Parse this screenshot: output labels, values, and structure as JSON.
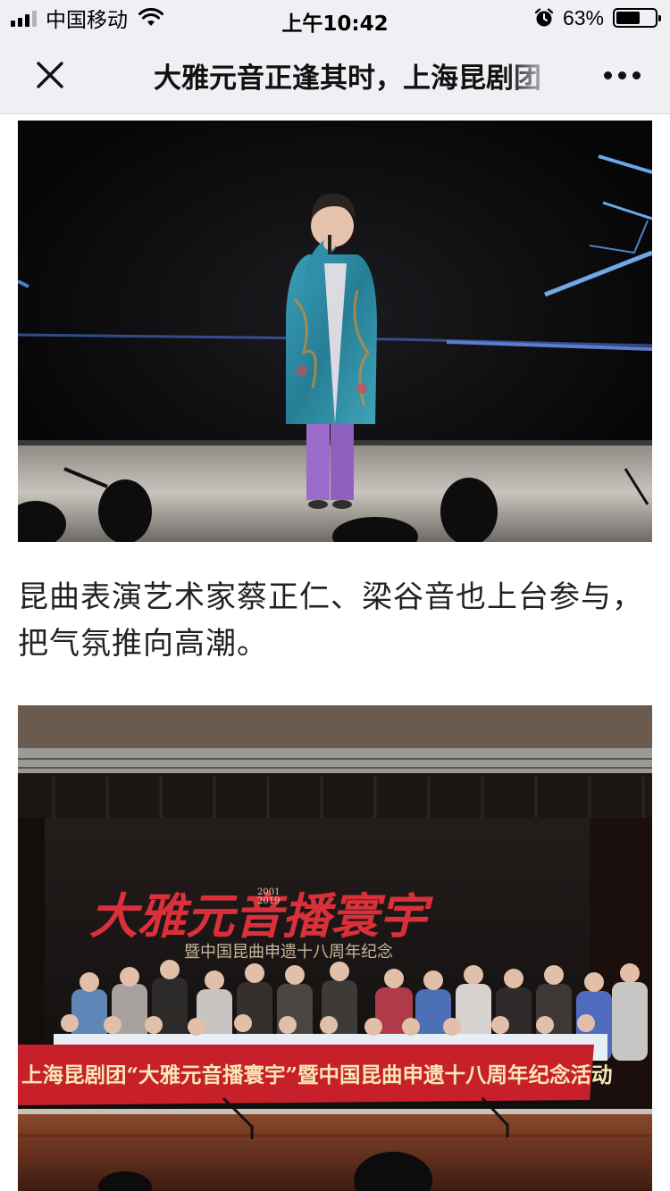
{
  "status_bar": {
    "carrier": "中国移动",
    "time": "上午10:42",
    "battery_percent": "63%",
    "battery_level": 0.63,
    "icons": [
      "signal-icon",
      "wifi-icon",
      "alarm-icon",
      "battery-icon"
    ]
  },
  "nav": {
    "title": "大雅元音正逢其时，上海昆剧团",
    "close_icon": "close-icon",
    "more_icon": "more-icon"
  },
  "article": {
    "caption": "昆曲表演艺术家蔡正仁、梁谷音也上台参与，把气氛推向高潮。",
    "banner": {
      "main_title": "大雅元音播寰宇",
      "year_top": "2001",
      "year_bottom": "2019",
      "subtitle": "暨中国昆曲申遗十八周年纪念",
      "red_banner": "上海昆剧团“大雅元音播寰宇”暨中国昆曲申遗十八周年纪念活动"
    }
  },
  "colors": {
    "bar_bg": "#efeff4",
    "banner_red": "#c8202a",
    "stage_dark": "#0b0b0d",
    "coat_teal": "#2e8fa8",
    "pants_purple": "#9b6cc9"
  }
}
